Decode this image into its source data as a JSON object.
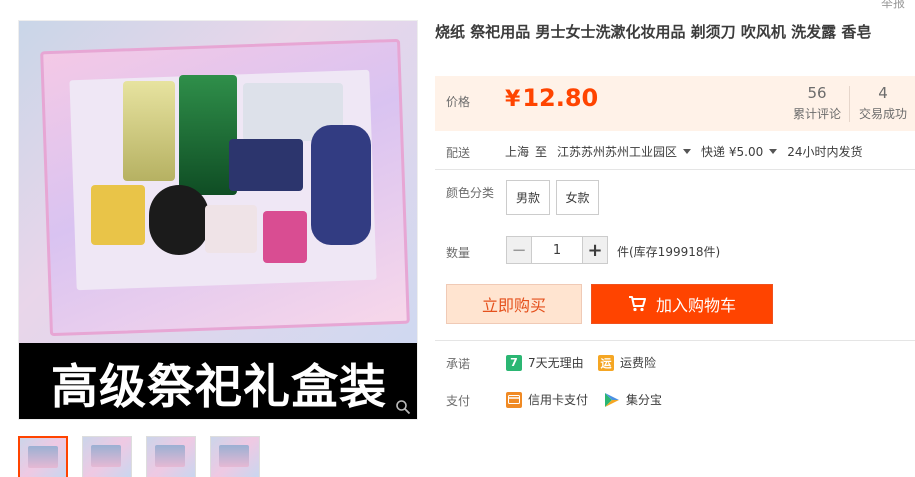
{
  "header": {
    "report_label": "举报"
  },
  "gallery": {
    "banner_text": "高级祭祀礼盒装",
    "thumbnails_count": 4
  },
  "product": {
    "title": "烧纸 祭祀用品 男士女士洗漱化妆用品 剃须刀 吹风机 洗发露 香皂",
    "price_label": "价格",
    "currency": "¥",
    "price": "12.80",
    "reviews_count": "56",
    "reviews_label": "累计评论",
    "sales_count": "4",
    "sales_label": "交易成功"
  },
  "shipping": {
    "label": "配送",
    "from": "上海",
    "to_word": "至",
    "to": "江苏苏州苏州工业园区",
    "method": "快递 ¥5.00",
    "dispatch": "24小时内发货"
  },
  "options": {
    "label": "颜色分类",
    "items": [
      "男款",
      "女款"
    ]
  },
  "quantity": {
    "label": "数量",
    "minus": "−",
    "value": "1",
    "plus": "+",
    "stock": "件(库存199918件)"
  },
  "actions": {
    "buy_now": "立即购买",
    "add_to_cart": "加入购物车"
  },
  "promise": {
    "label": "承诺",
    "items": [
      {
        "text": "7天无理由",
        "icon": "seven-days-icon",
        "color": "#2bb673"
      },
      {
        "text": "运费险",
        "icon": "shipping-insurance-icon",
        "color": "#f5a623"
      }
    ]
  },
  "payment": {
    "label": "支付",
    "items": [
      {
        "text": "信用卡支付",
        "icon": "credit-card-icon",
        "color": "#f08a24"
      },
      {
        "text": "集分宝",
        "icon": "jifenbao-icon",
        "color": "#4a90e2"
      }
    ]
  },
  "colors": {
    "accent": "#ff4400",
    "price_bg": "#fff2e8",
    "buy_now_bg": "#ffe4d0"
  }
}
